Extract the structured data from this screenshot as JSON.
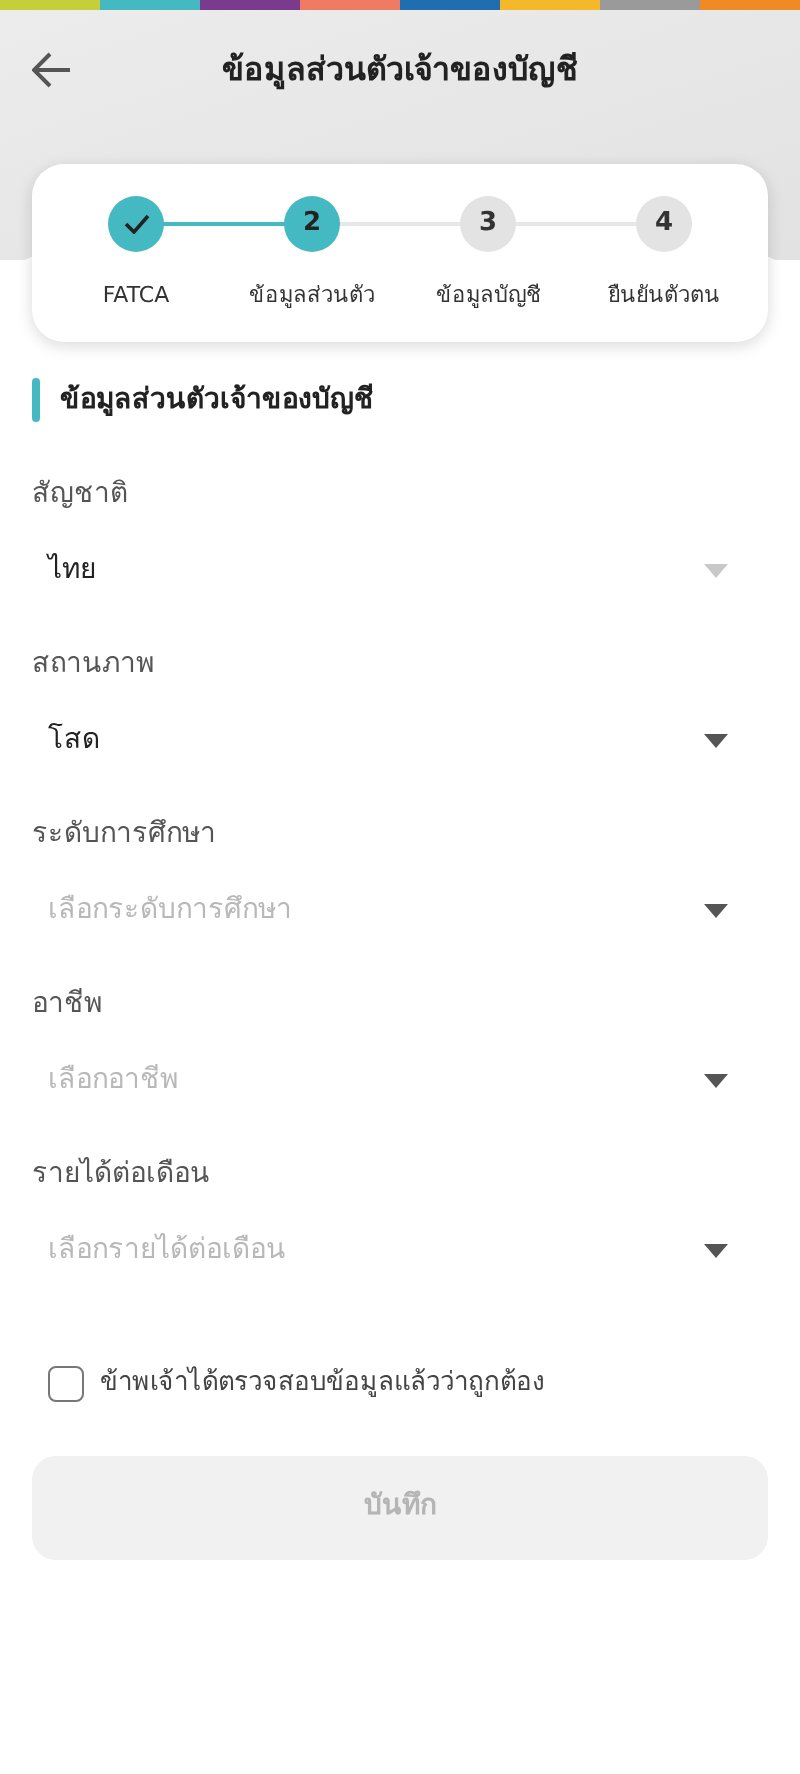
{
  "header": {
    "title": "ข้อมูลส่วนตัวเจ้าของบัญชี"
  },
  "steps": [
    {
      "kind": "done",
      "label": "FATCA"
    },
    {
      "kind": "current",
      "number": "2",
      "label": "ข้อมูลส่วนตัว"
    },
    {
      "kind": "pending",
      "number": "3",
      "label": "ข้อมูลบัญชี"
    },
    {
      "kind": "pending",
      "number": "4",
      "label": "ยืนยันตัวตน"
    }
  ],
  "section_title": "ข้อมูลส่วนตัวเจ้าของบัญชี",
  "fields": [
    {
      "label": "สัญชาติ",
      "value": "ไทย",
      "disabled": true
    },
    {
      "label": "สถานภาพ",
      "value": "โสด",
      "disabled": false
    },
    {
      "label": "ระดับการศึกษา",
      "placeholder": "เลือกระดับการศึกษา",
      "disabled": false
    },
    {
      "label": "อาชีพ",
      "placeholder": "เลือกอาชีพ",
      "disabled": false
    },
    {
      "label": "รายได้ต่อเดือน",
      "placeholder": "เลือกรายได้ต่อเดือน",
      "disabled": false
    }
  ],
  "confirm": {
    "label": "ข้าพเจ้าได้ตรวจสอบข้อมูลแล้วว่าถูกต้อง",
    "checked": false
  },
  "save_button": {
    "label": "บันทึก",
    "disabled": true
  }
}
